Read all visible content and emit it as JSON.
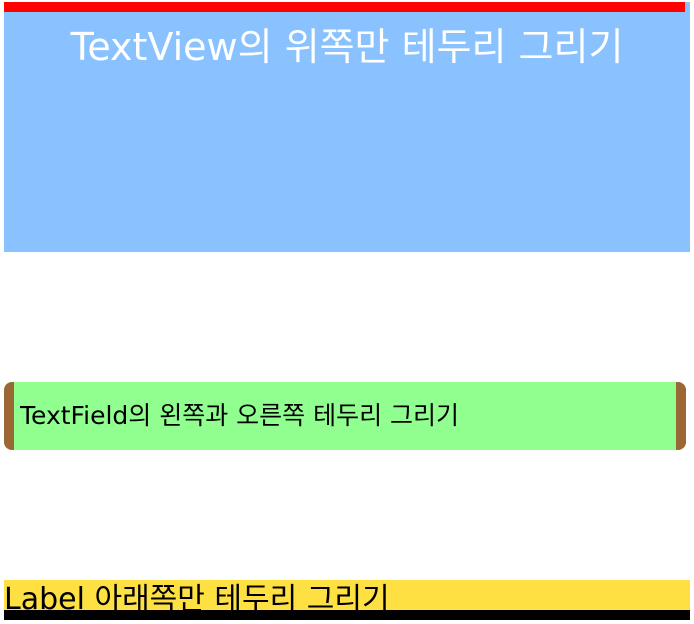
{
  "textview": {
    "text": "TextView의 위쪽만 테두리 그리기",
    "background_color": "#8ac2ff",
    "text_color": "#ffffff",
    "border_color": "#ff0000"
  },
  "textfield": {
    "value": "TextField의 왼쪽과 오른쪽 테두리 그리기",
    "background_color": "#90ff90",
    "border_color": "#9a6735"
  },
  "label": {
    "text": "Label 아래쪽만 테두리 그리기",
    "background_color": "#ffe043",
    "border_color": "#000000"
  }
}
